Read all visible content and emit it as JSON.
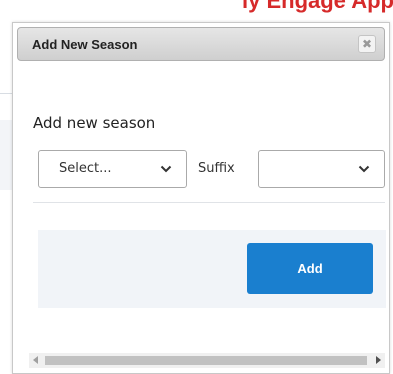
{
  "background": {
    "heading_fragment": "ly Engage App"
  },
  "dialog": {
    "title": "Add New Season",
    "close_symbol": "✖",
    "heading": "Add new season",
    "season_select": {
      "value": "Select..."
    },
    "suffix_label": "Suffix",
    "suffix_select": {
      "value": ""
    },
    "add_label": "Add"
  },
  "colors": {
    "accent": "#1a7fcf",
    "heading_red": "#d62a2a",
    "footer_bg": "#f1f4f8"
  },
  "icons": {
    "close": "close-icon",
    "dropdown": "chevron-down-icon",
    "scroll_left": "arrow-left-icon",
    "scroll_right": "arrow-right-icon"
  }
}
